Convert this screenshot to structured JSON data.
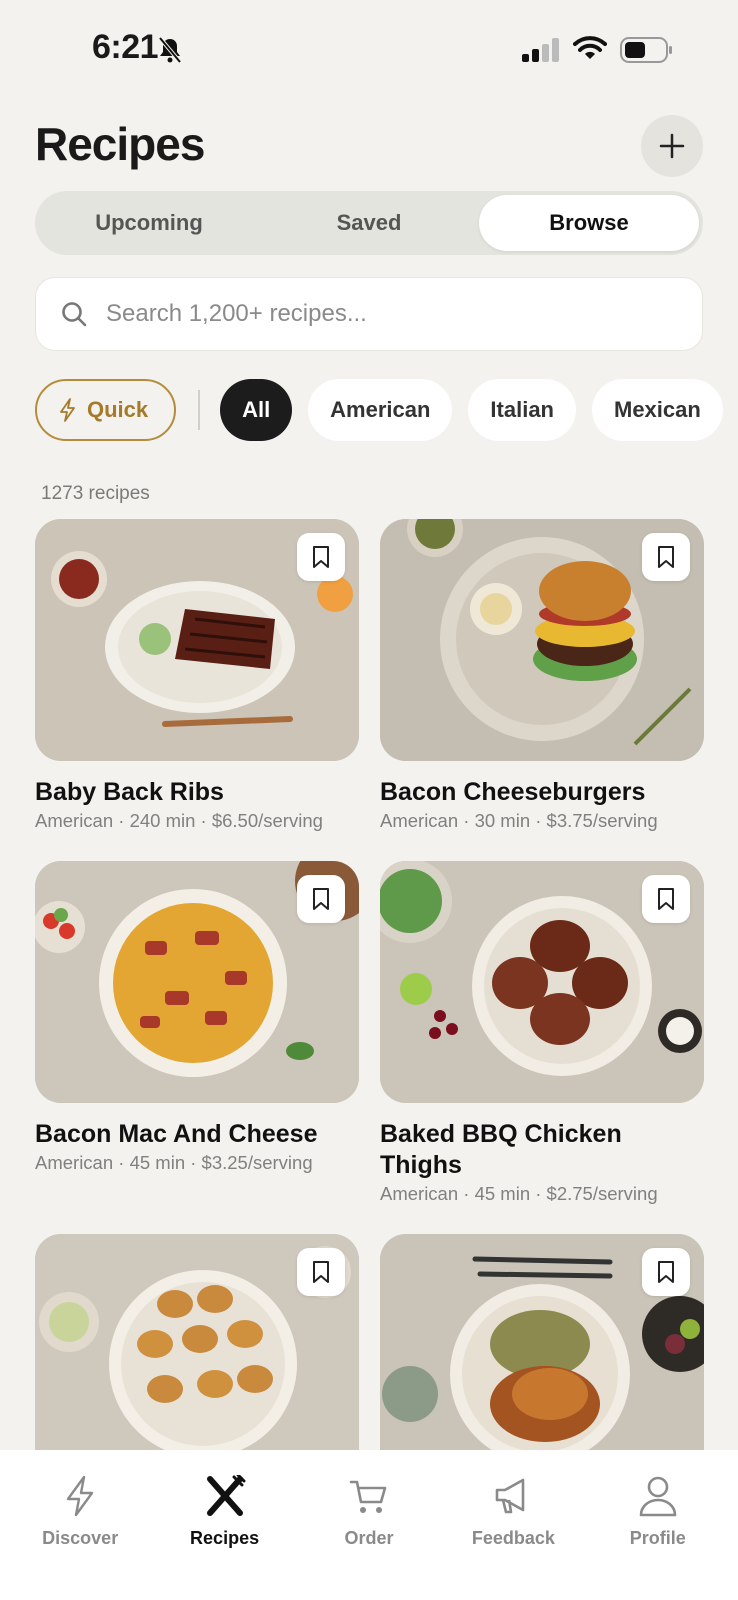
{
  "status_bar": {
    "time": "6:21"
  },
  "header": {
    "title": "Recipes",
    "add_icon": "plus-icon"
  },
  "tabs": [
    {
      "label": "Upcoming",
      "active": false
    },
    {
      "label": "Saved",
      "active": false
    },
    {
      "label": "Browse",
      "active": true
    }
  ],
  "search": {
    "placeholder": "Search 1,200+ recipes..."
  },
  "filters": {
    "quick_label": "Quick",
    "chips": [
      "All",
      "American",
      "Italian",
      "Mexican"
    ],
    "selected": "All"
  },
  "results": {
    "count_label": "1273 recipes"
  },
  "recipes": [
    {
      "title": "Baby Back Ribs",
      "meta": "American · 240 min · $6.50/serving"
    },
    {
      "title": "Bacon Cheeseburgers",
      "meta": "American · 30 min · $3.75/serving"
    },
    {
      "title": "Bacon Mac And Cheese",
      "meta": "American · 45 min · $3.25/serving"
    },
    {
      "title": "Baked BBQ Chicken Thighs",
      "meta": "American · 45 min · $2.75/serving"
    },
    {
      "title": "",
      "meta": ""
    },
    {
      "title": "",
      "meta": ""
    }
  ],
  "bottom_nav": [
    {
      "label": "Discover",
      "icon": "lightning-icon",
      "active": false
    },
    {
      "label": "Recipes",
      "icon": "fork-knife-icon",
      "active": true
    },
    {
      "label": "Order",
      "icon": "cart-icon",
      "active": false
    },
    {
      "label": "Feedback",
      "icon": "megaphone-icon",
      "active": false
    },
    {
      "label": "Profile",
      "icon": "person-icon",
      "active": false
    }
  ],
  "colors": {
    "accent": "#b48c3c",
    "background": "#f3f2ee",
    "selected_chip": "#1c1c1c"
  }
}
